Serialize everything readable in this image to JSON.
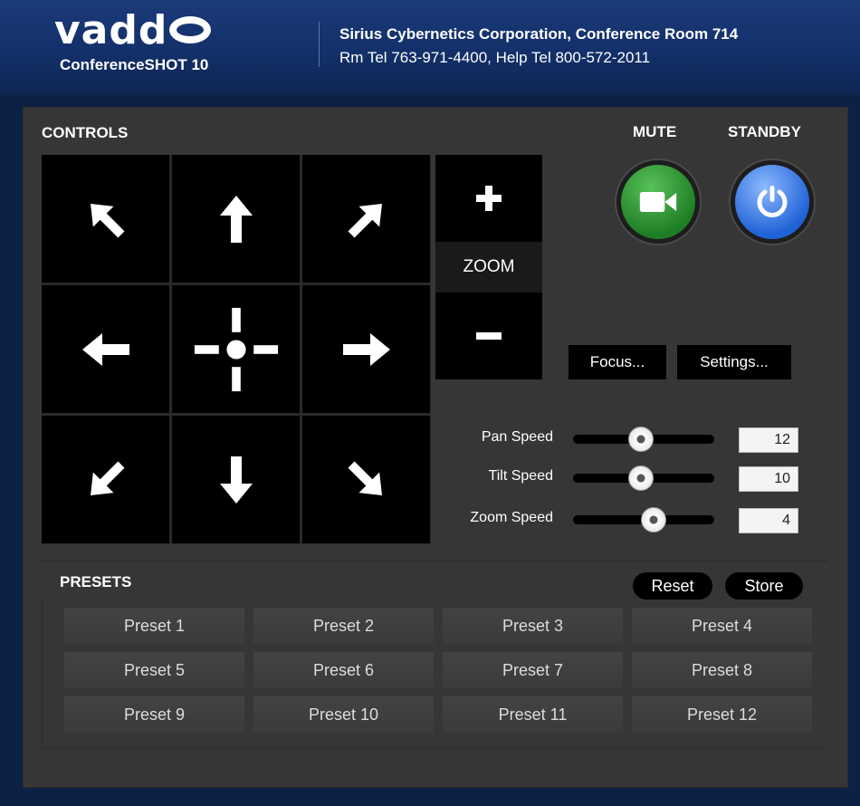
{
  "header": {
    "brand": "vadd",
    "model": "ConferenceSHOT 10",
    "company": "Sirius Cybernetics Corporation, Conference Room 714",
    "phones": "Rm Tel 763-971-4400, Help Tel 800-572-2011"
  },
  "controls": {
    "title": "CONTROLS",
    "zoom_label": "ZOOM",
    "pad_icons": [
      "arrow-up-left-icon",
      "arrow-up-icon",
      "arrow-up-right-icon",
      "arrow-left-icon",
      "home-crosshair-icon",
      "arrow-right-icon",
      "arrow-down-left-icon",
      "arrow-down-icon",
      "arrow-down-right-icon"
    ]
  },
  "mute": {
    "label": "MUTE",
    "icon": "video-camera-icon",
    "color": "#2e9a32"
  },
  "standby": {
    "label": "STANDBY",
    "icon": "power-icon",
    "color": "#2f6fe0"
  },
  "buttons": {
    "focus": "Focus...",
    "settings": "Settings..."
  },
  "speeds": {
    "pan": {
      "label": "Pan Speed",
      "value": "12",
      "level": 0.48
    },
    "tilt": {
      "label": "Tilt Speed",
      "value": "10",
      "level": 0.48
    },
    "zoom": {
      "label": "Zoom Speed",
      "value": "4",
      "level": 0.57
    }
  },
  "presets": {
    "title": "PRESETS",
    "reset": "Reset",
    "store": "Store",
    "items": [
      "Preset 1",
      "Preset 2",
      "Preset 3",
      "Preset 4",
      "Preset 5",
      "Preset 6",
      "Preset 7",
      "Preset 8",
      "Preset 9",
      "Preset 10",
      "Preset 11",
      "Preset 12"
    ]
  }
}
